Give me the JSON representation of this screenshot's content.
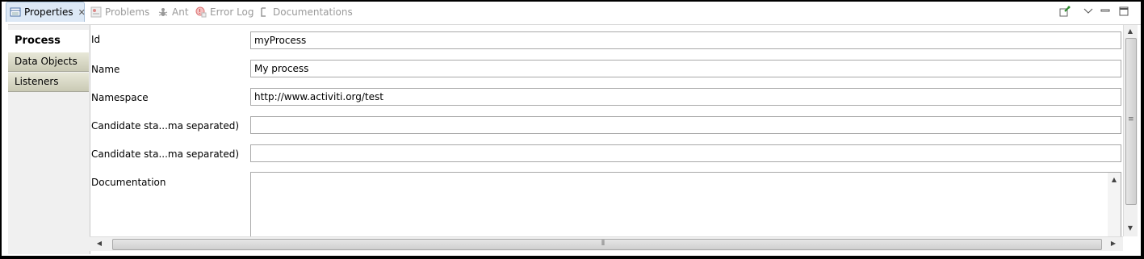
{
  "tabs": [
    {
      "label": "Properties",
      "icon": "properties-icon",
      "active": true
    },
    {
      "label": "Problems",
      "icon": "problems-icon"
    },
    {
      "label": "Ant",
      "icon": "ant-icon"
    },
    {
      "label": "Error Log",
      "icon": "error-log-icon"
    },
    {
      "label": "Documentations",
      "icon": "documentation-icon"
    }
  ],
  "toolbar": {
    "icons": [
      "pin-icon",
      "view-menu-icon",
      "minimize-icon",
      "maximize-icon"
    ]
  },
  "sidebar": {
    "items": [
      {
        "label": "Process",
        "selected": true
      },
      {
        "label": "Data Objects"
      },
      {
        "label": "Listeners"
      }
    ]
  },
  "form": {
    "fields": [
      {
        "label": "Id",
        "value": "myProcess"
      },
      {
        "label": "Name",
        "value": "My process"
      },
      {
        "label": "Namespace",
        "value": "http://www.activiti.org/test"
      },
      {
        "label": "Candidate sta...ma separated)",
        "value": ""
      },
      {
        "label": "Candidate sta...ma separated)",
        "value": ""
      },
      {
        "label": "Documentation",
        "value": ""
      }
    ]
  },
  "colors": {
    "active_tab": "#dce8f5",
    "sidebar_tab": "#c9c9b4",
    "border": "#a9a9a9"
  }
}
